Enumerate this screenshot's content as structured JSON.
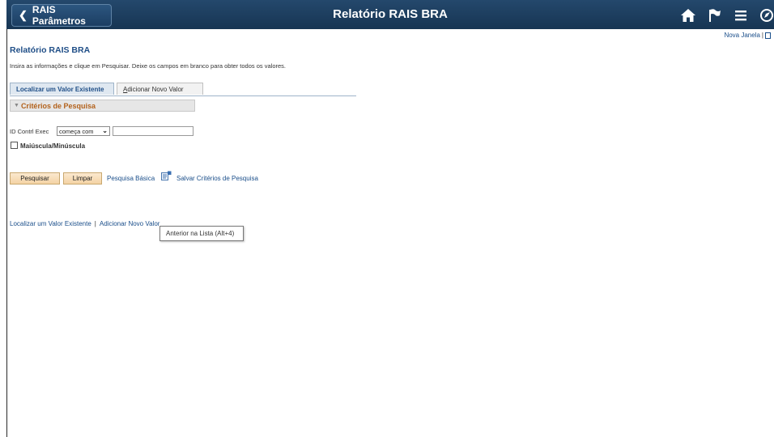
{
  "header": {
    "back_label": "RAIS Parâmetros",
    "title": "Relatório RAIS BRA",
    "icons": [
      "home-icon",
      "flag-icon",
      "menu-icon",
      "navbar-icon"
    ],
    "colors": {
      "bar": "#1f3d5c",
      "text": "#ffffff"
    }
  },
  "top_links": {
    "new_window": "Nova Janela",
    "separator": "|"
  },
  "page": {
    "title": "Relatório RAIS BRA",
    "instructions": "Insira as informações e clique em Pesquisar. Deixe os campos em branco para obter todos os valores."
  },
  "tabs": [
    {
      "label": "Localizar um Valor Existente",
      "active": true
    },
    {
      "label_first": "A",
      "label_rest": "dicionar Novo Valor",
      "active": false
    }
  ],
  "criteria": {
    "title": "Critérios de Pesquisa"
  },
  "search": {
    "field_label": "ID Contrl Exec",
    "operator_selected": "começa com",
    "value": "",
    "case_label": "Maiúscula/Minúscula"
  },
  "actions": {
    "search_button": "Pesquisar",
    "clear_button": "Limpar",
    "basic_search_link": "Pesquisa Básica",
    "save_criteria_link": "Salvar Critérios de Pesquisa"
  },
  "bottom_links": {
    "find_existing": "Localizar um Valor Existente",
    "separator": "|",
    "add_new": "Adicionar Novo Valor"
  },
  "tooltip": {
    "text": "Anterior na Lista (Alt+4)"
  },
  "colors": {
    "link": "#1a4e8a",
    "section_title": "#b3621c",
    "button": "#f4d3a4"
  }
}
